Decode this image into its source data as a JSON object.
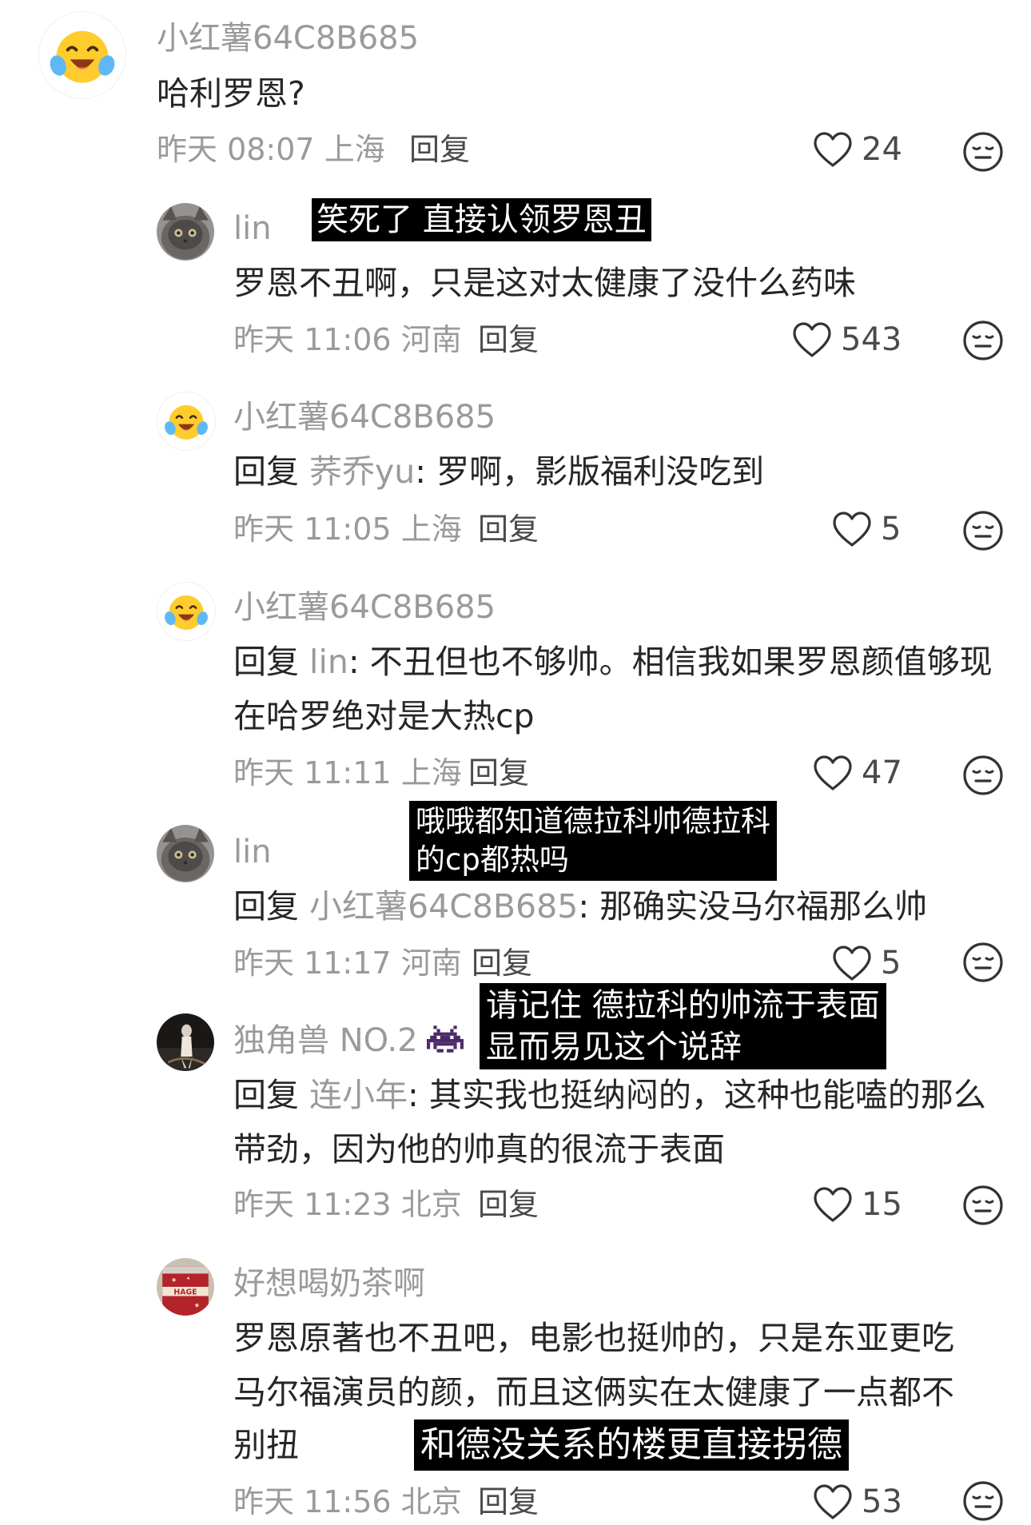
{
  "comments": [
    {
      "name": "小红薯64C8B685",
      "text": "哈利罗恩?",
      "time": "昨天 08:07",
      "location": "上海",
      "reply_label": "回复",
      "likes": "24"
    },
    {
      "name": "lin",
      "text": "罗恩不丑啊，只是这对太健康了没什么药味",
      "time": "昨天 11:06",
      "location": "河南",
      "reply_label": "回复",
      "likes": "543"
    },
    {
      "name": "小红薯64C8B685",
      "reply_prefix": "回复",
      "reply_to": "荞乔yu",
      "text": ": 罗啊，影版福利没吃到",
      "time": "昨天 11:05",
      "location": "上海",
      "reply_label": "回复",
      "likes": "5"
    },
    {
      "name": "小红薯64C8B685",
      "reply_prefix": "回复",
      "reply_to": "lin",
      "text_line1": ": 不丑但也不够帅。相信我如果罗恩颜值够现",
      "text_line2": "在哈罗绝对是大热cp",
      "time": "昨天 11:11",
      "location": "上海",
      "reply_label": "回复",
      "likes": "47"
    },
    {
      "name": "lin",
      "reply_prefix": "回复",
      "reply_to": "小红薯64C8B685",
      "text": ": 那确实没马尔福那么帅",
      "time": "昨天 11:17",
      "location": "河南",
      "reply_label": "回复",
      "likes": "5"
    },
    {
      "name": "独角兽 NO.2",
      "reply_prefix": "回复",
      "reply_to": "连小年",
      "text_line1": ": 其实我也挺纳闷的，这种也能嗑的那么",
      "text_line2": "带劲，因为他的帅真的很流于表面",
      "time": "昨天 11:23",
      "location": "北京",
      "reply_label": "回复",
      "likes": "15"
    },
    {
      "name": "好想喝奶茶啊",
      "text_line1": "罗恩原著也不丑吧，电影也挺帅的，只是东亚更吃",
      "text_line2": "马尔福演员的颜，而且这俩实在太健康了一点都不",
      "text_line3": "别扭",
      "time": "昨天 11:56",
      "location": "北京",
      "reply_label": "回复",
      "likes": "53"
    }
  ],
  "captions": {
    "c1": "笑死了 直接认领罗恩丑",
    "c2_line1": "哦哦都知道德拉科帅德拉科",
    "c2_line2": "的cp都热吗",
    "c3_line1": "请记住 德拉科的帅流于表面",
    "c3_line2": "显而易见这个说辞",
    "c4": "和德没关系的楼更直接拐德"
  },
  "icons": {
    "like": "heart-outline-icon",
    "dislike": "neutral-face-icon",
    "avatar_emoji": "laughing-crying-emoji",
    "name_emoji": "space-invader-emoji"
  },
  "colors": {
    "name": "#9a9a9a",
    "text": "#262626",
    "caption_bg": "#000000"
  }
}
